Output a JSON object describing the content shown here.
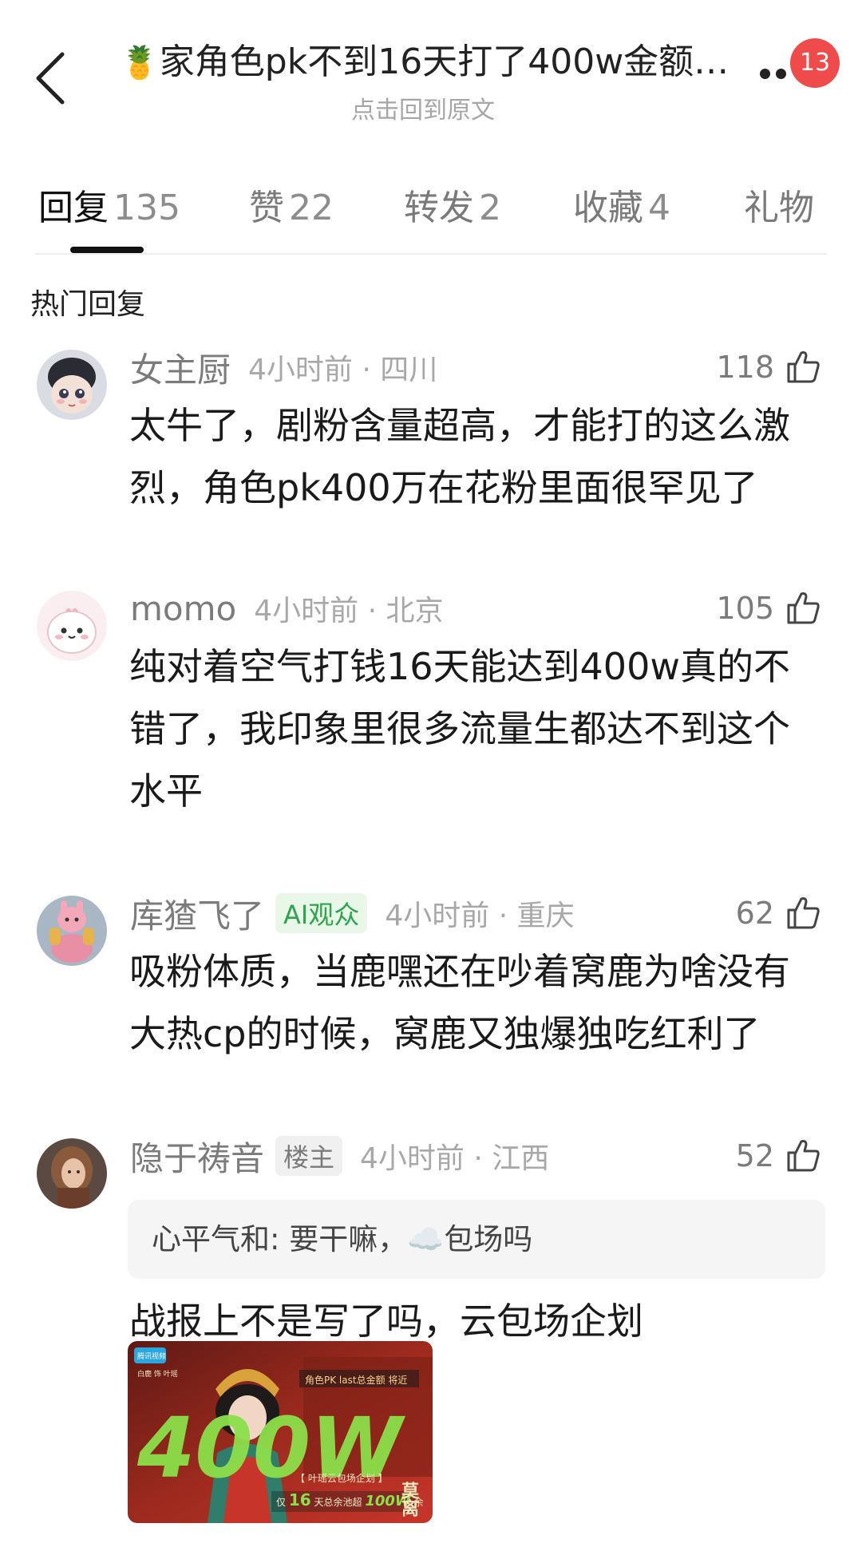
{
  "header": {
    "title_emoji": "🍍",
    "title": "家角色pk不到16天打了400w金额…",
    "subtitle": "点击回到原文",
    "notification_count": "13"
  },
  "tabs": [
    {
      "name": "回复",
      "count": "135",
      "active": true
    },
    {
      "name": "赞",
      "count": "22",
      "active": false
    },
    {
      "name": "转发",
      "count": "2",
      "active": false
    },
    {
      "name": "收藏",
      "count": "4",
      "active": false
    },
    {
      "name": "礼物",
      "count": "",
      "active": false
    }
  ],
  "section_title": "热门回复",
  "comments": [
    {
      "name": "女主厨",
      "time": "4小时前",
      "location": "四川",
      "likes": "118",
      "lines": [
        "太牛了，剧粉含量超高，才能打的这么激",
        "烈，角色pk400万在花粉里面很罕见了"
      ]
    },
    {
      "name": "momo",
      "time": "4小时前",
      "location": "北京",
      "likes": "105",
      "lines": [
        "纯对着空气打钱16天能达到400w真的不",
        "错了，我印象里很多流量生都达不到这个",
        "水平"
      ]
    },
    {
      "name": "库猹飞了",
      "tag": "AI观众",
      "time": "4小时前",
      "location": "重庆",
      "likes": "62",
      "lines": [
        "吸粉体质，当鹿嘿还在吵着窝鹿为啥没有",
        "大热cp的时候，窝鹿又独爆独吃红利了"
      ]
    },
    {
      "name": "隐于祷音",
      "tag": "楼主",
      "time": "4小时前",
      "location": "江西",
      "likes": "52",
      "quote_user": "心平气和",
      "quote_text": "要干嘛，",
      "quote_emoji": "☁️",
      "quote_text2": "包场吗",
      "lines": [
        "战报上不是写了吗，云包场企划"
      ],
      "image": {
        "big_text": "400W",
        "banner": "角色PK last总金额 将近",
        "sub_banner": "【 叶瑶云包场企划 】",
        "footer_pre": "仅",
        "footer_num": "16",
        "footer_mid": "天总余池超",
        "footer_amount": "100W",
        "footer_suf": "余",
        "side_text": "莫离",
        "logo_text": "腾讯视频",
        "cast_text": "白鹿 饰 叶瑶"
      }
    }
  ],
  "colors": {
    "badge": "#f04b4b",
    "ai_tag_bg": "#e8f7e8",
    "ai_tag_text": "#2ea44f",
    "image_red": "#b3261e",
    "image_green": "#8be04a"
  },
  "icons": [
    "back-arrow-icon",
    "more-dots-icon",
    "thumbs-up-icon"
  ]
}
